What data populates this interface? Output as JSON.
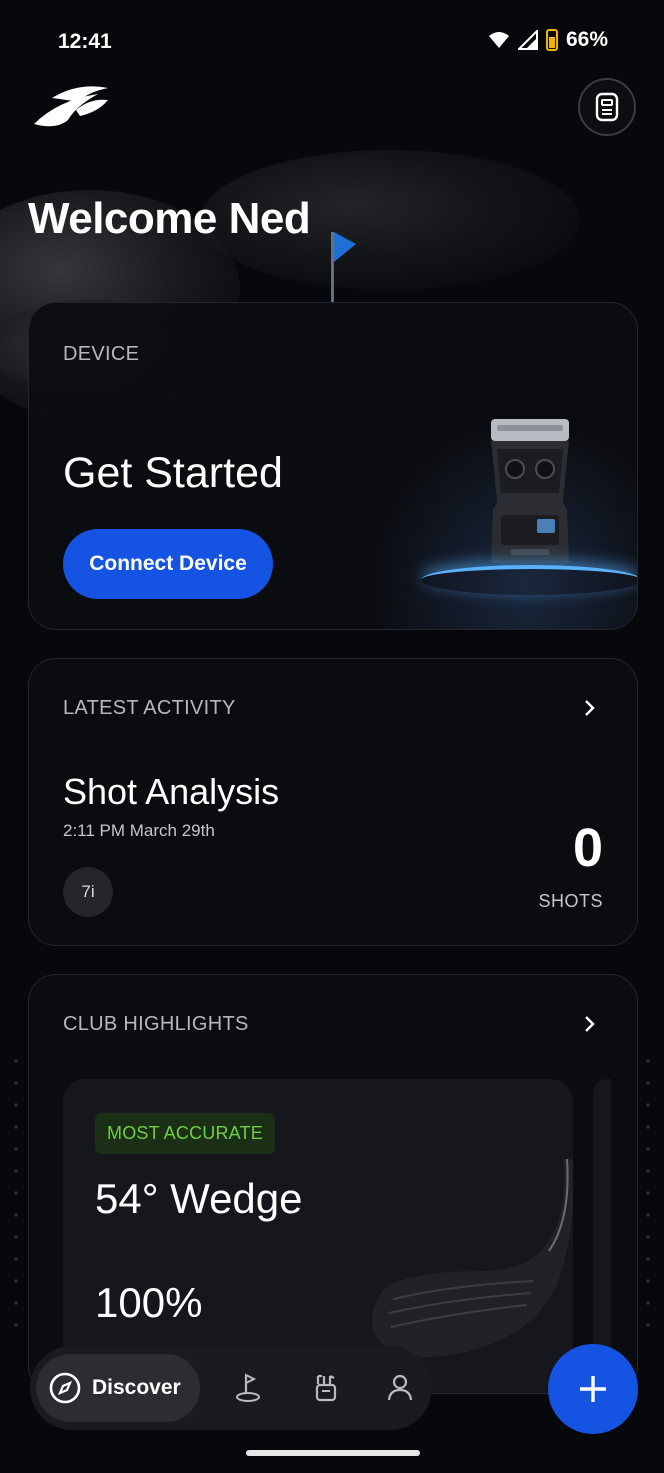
{
  "status_bar": {
    "time": "12:41",
    "battery": "66%"
  },
  "header": {
    "welcome": "Welcome Ned"
  },
  "device_card": {
    "label": "DEVICE",
    "title": "Get Started",
    "button": "Connect Device"
  },
  "activity_card": {
    "label": "LATEST ACTIVITY",
    "title": "Shot Analysis",
    "date": "2:11 PM  March 29th",
    "club": "7i",
    "shots": "0",
    "shots_unit": "SHOTS"
  },
  "highlights_card": {
    "label": "CLUB HIGHLIGHTS",
    "badge": "MOST ACCURATE",
    "club": "54° Wedge",
    "value": "100%"
  },
  "nav": {
    "discover": "Discover",
    "icons": [
      "compass-icon",
      "golf-flag-icon",
      "golf-bag-icon",
      "profile-icon",
      "plus-icon"
    ]
  },
  "colors": {
    "accent": "#1553e3",
    "badge_text": "#6ed13f",
    "badge_bg": "#1b2e16",
    "battery": "#f0b400"
  }
}
